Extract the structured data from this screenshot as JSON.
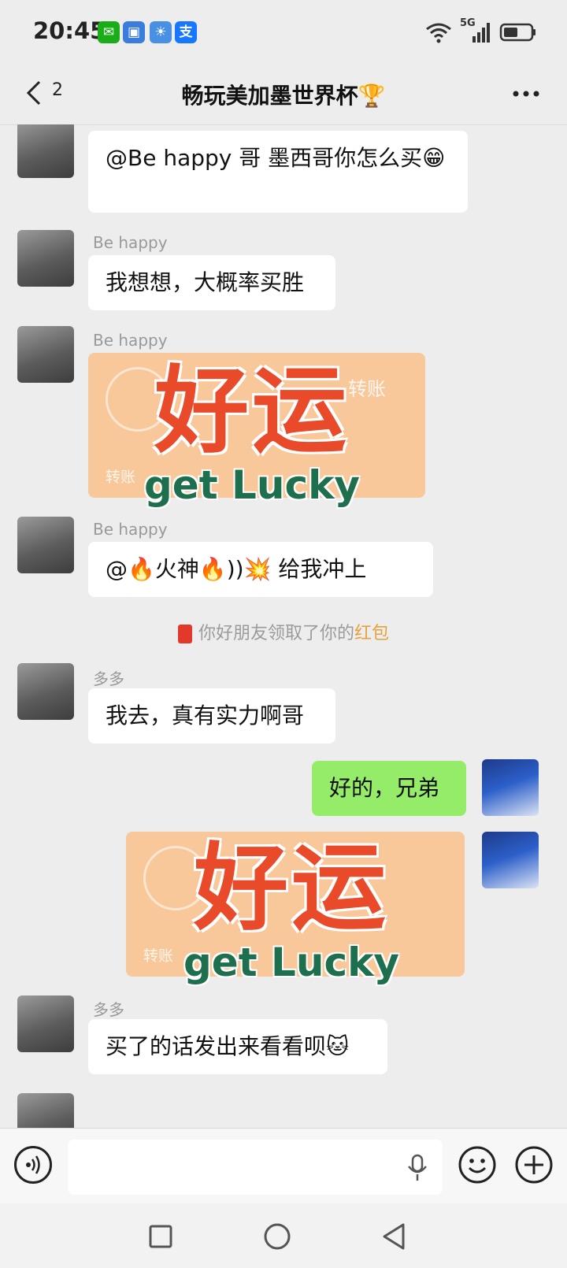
{
  "status": {
    "time": "20:45",
    "network": "5G",
    "apps": [
      {
        "name": "wechat-app-icon",
        "glyph": "✉",
        "color": "#1aad19"
      },
      {
        "name": "calendar-app-icon",
        "glyph": "▣",
        "color": "#3b7ddd"
      },
      {
        "name": "weather-app-icon",
        "glyph": "☀",
        "color": "#4a90e2"
      },
      {
        "name": "alipay-app-icon",
        "glyph": "支",
        "color": "#1677ff"
      }
    ]
  },
  "header": {
    "unread": "2",
    "title": "畅玩美加墨世界杯🏆"
  },
  "messages": {
    "m1": {
      "text": "@Be happy 哥 墨西哥你怎么买😁"
    },
    "m2": {
      "nick": "Be happy",
      "text": "我想想，大概率买胜"
    },
    "m3": {
      "nick": "Be happy",
      "transfer_title": "转账",
      "transfer_label": "转账",
      "sticker_cn": "好运",
      "sticker_en": "get Lucky"
    },
    "m4": {
      "nick": "Be happy",
      "text": "@🔥火神🔥))💥 给我冲上"
    },
    "sys1": {
      "prefix": "你好朋友领取了你的",
      "highlight": "红包"
    },
    "m5": {
      "nick": "多多",
      "text": "我去，真有实力啊哥"
    },
    "m6": {
      "text": "好的，兄弟"
    },
    "m7": {
      "transfer_label": "转账",
      "sticker_cn": "好运",
      "sticker_en": "get Lucky"
    },
    "m8": {
      "nick": "多多",
      "text": "买了的话发出来看看呗🐱"
    }
  },
  "input": {
    "placeholder": ""
  }
}
